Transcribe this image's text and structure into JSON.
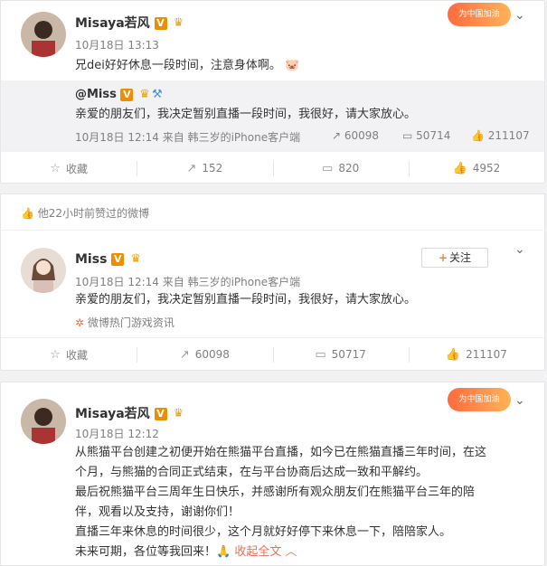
{
  "post1": {
    "author": "Misaya若风",
    "badge_v": "V",
    "time": "10月18日 13:13",
    "text": "兄dei好好休息一段时间，注意身体啊。",
    "emoji": "🐷",
    "sticker": "为中国加油",
    "repost": {
      "author": "@Miss",
      "text": "亲爱的朋友们，我决定暂别直播一段时间，我很好，请大家放心。",
      "meta": "10月18日 12:14 来自 韩三岁的iPhone客户端",
      "stats": {
        "reposts": "60098",
        "comments": "50714",
        "likes": "211107"
      }
    },
    "actions": {
      "favorite": "收藏",
      "reposts": "152",
      "comments": "820",
      "likes": "4952"
    }
  },
  "liked_bar": {
    "text": "他22小时前赞过的微博"
  },
  "post2": {
    "author": "Miss",
    "badge_v": "V",
    "meta": "10月18日 12:14 来自 韩三岁的iPhone客户端",
    "follow_label": "关注",
    "text": "亲爱的朋友们，我决定暂别直播一段时间，我很好，请大家放心。",
    "source_tag": "微博热门游戏资讯",
    "actions": {
      "favorite": "收藏",
      "reposts": "60098",
      "comments": "50717",
      "likes": "211107"
    }
  },
  "post3": {
    "author": "Misaya若风",
    "badge_v": "V",
    "time": "10月18日 12:12",
    "sticker": "为中国加油",
    "lines": [
      "从熊猫平台创建之初便开始在熊猫平台直播，如今已在熊猫直播三年时间，在这",
      "个月，与熊猫的合同正式结束，在与平台协商后达成一致和平解约。",
      "最后祝熊猫平台三周年生日快乐，并感谢所有观众朋友们在熊猫平台三年的陪",
      "伴，观看以及支持，谢谢你们！",
      "直播三年来休息的时间很少，这个月就好好停下来休息一下，陪陪家人。",
      "未来可期，各位等我回来！"
    ],
    "collapse_label": "收起全文"
  },
  "colors": {
    "accent": "#eb7350",
    "verified": "#f08c00"
  }
}
